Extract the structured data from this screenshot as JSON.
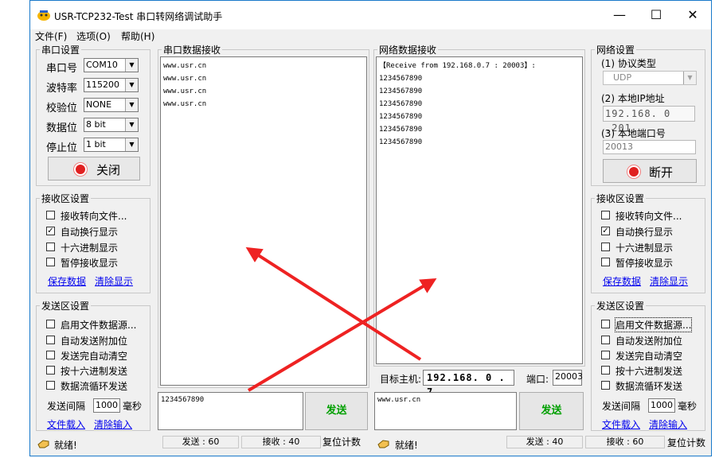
{
  "window": {
    "title": "USR-TCP232-Test 串口转网络调试助手",
    "min": "—",
    "max": "☐",
    "close": "✕"
  },
  "menu": [
    "文件(F)",
    "选项(O)",
    "帮助(H)"
  ],
  "serial_settings": {
    "title": "串口设置",
    "port_label": "串口号",
    "port_value": "COM10",
    "baud_label": "波特率",
    "baud_value": "115200",
    "parity_label": "校验位",
    "parity_value": "NONE",
    "databits_label": "数据位",
    "databits_value": "8 bit",
    "stopbits_label": "停止位",
    "stopbits_value": "1 bit",
    "close_button": "关闭"
  },
  "serial_recv_options": {
    "title": "接收区设置",
    "items": [
      {
        "label": "接收转向文件...",
        "checked": false
      },
      {
        "label": "自动换行显示",
        "checked": true
      },
      {
        "label": "十六进制显示",
        "checked": false
      },
      {
        "label": "暂停接收显示",
        "checked": false
      }
    ],
    "save_link": "保存数据",
    "clear_link": "清除显示"
  },
  "serial_send_options": {
    "title": "发送区设置",
    "items": [
      {
        "label": "启用文件数据源...",
        "checked": false
      },
      {
        "label": "自动发送附加位",
        "checked": false
      },
      {
        "label": "发送完自动清空",
        "checked": false
      },
      {
        "label": "按十六进制发送",
        "checked": false
      },
      {
        "label": "数据流循环发送",
        "checked": false
      }
    ],
    "interval_label": "发送间隔",
    "interval_value": "1000",
    "interval_unit": "毫秒",
    "load_link": "文件载入",
    "clear_link": "清除输入"
  },
  "serial_receive": {
    "title": "串口数据接收",
    "lines": [
      "www.usr.cn",
      "www.usr.cn",
      "www.usr.cn",
      "www.usr.cn"
    ]
  },
  "serial_send": {
    "text": "1234567890",
    "button": "发送"
  },
  "network_receive": {
    "title": "网络数据接收",
    "lines": [
      "【Receive from 192.168.0.7 : 20003】:",
      "1234567890",
      "1234567890",
      "1234567890",
      "1234567890",
      "1234567890",
      "1234567890"
    ]
  },
  "network_target": {
    "host_label": "目标主机:",
    "host_value": "192.168. 0 . 7",
    "port_label": "端口:",
    "port_value": "20003"
  },
  "network_send": {
    "text": "www.usr.cn",
    "button": "发送"
  },
  "network_settings": {
    "title": "网络设置",
    "protocol_label": "(1) 协议类型",
    "protocol_value": "UDP",
    "ip_label": "(2) 本地IP地址",
    "ip_value": "192.168. 0 .201",
    "port_label": "(3) 本地端口号",
    "port_value": "20013",
    "disconnect_button": "断开"
  },
  "network_recv_options": {
    "title": "接收区设置",
    "items": [
      {
        "label": "接收转向文件...",
        "checked": false
      },
      {
        "label": "自动换行显示",
        "checked": true
      },
      {
        "label": "十六进制显示",
        "checked": false
      },
      {
        "label": "暂停接收显示",
        "checked": false
      }
    ],
    "save_link": "保存数据",
    "clear_link": "清除显示"
  },
  "network_send_options": {
    "title": "发送区设置",
    "items": [
      {
        "label": "启用文件数据源...",
        "checked": false
      },
      {
        "label": "自动发送附加位",
        "checked": false
      },
      {
        "label": "发送完自动清空",
        "checked": false
      },
      {
        "label": "按十六进制发送",
        "checked": false
      },
      {
        "label": "数据流循环发送",
        "checked": false
      }
    ],
    "interval_label": "发送间隔",
    "interval_value": "1000",
    "interval_unit": "毫秒",
    "load_link": "文件载入",
    "clear_link": "清除输入"
  },
  "status_left": {
    "ready": "就绪!",
    "sent": "发送 : 60",
    "received": "接收 : 40",
    "reset": "复位计数"
  },
  "status_right": {
    "ready": "就绪!",
    "sent": "发送 : 40",
    "received": "接收 : 60",
    "reset": "复位计数"
  },
  "colors": {
    "accent_arrow": "#ee2222",
    "send_text": "#00a000",
    "link": "#0000ee",
    "title_border": "#1979ca"
  }
}
